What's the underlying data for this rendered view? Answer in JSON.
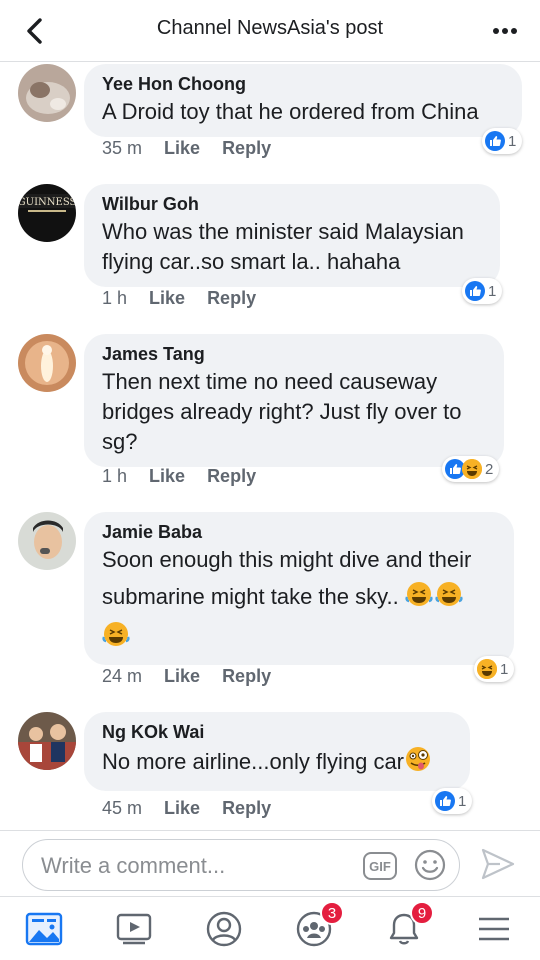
{
  "header": {
    "title": "Channel NewsAsia's post"
  },
  "comments": [
    {
      "name": "Yee Hon Choong",
      "lines": [
        "A Droid toy that he ordered from China"
      ],
      "time": "35 m",
      "like_label": "Like",
      "reply_label": "Reply",
      "reaction_count": "1",
      "reactions": [
        "like"
      ]
    },
    {
      "name": "Wilbur Goh",
      "lines": [
        "Who was the minister said Malaysian",
        "flying car..so smart la.. hahaha"
      ],
      "time": "1 h",
      "like_label": "Like",
      "reply_label": "Reply",
      "reaction_count": "1",
      "reactions": [
        "like"
      ],
      "avatar_text": "GUINNESS"
    },
    {
      "name": "James Tang",
      "lines": [
        "Then next time no need causeway",
        "bridges already right? Just fly over to",
        "sg?"
      ],
      "time": "1 h",
      "like_label": "Like",
      "reply_label": "Reply",
      "reaction_count": "2",
      "reactions": [
        "like",
        "haha"
      ]
    },
    {
      "name": "Jamie Baba",
      "lines": [
        "Soon enough this might dive and their",
        "submarine might take the sky.."
      ],
      "time": "24 m",
      "like_label": "Like",
      "reply_label": "Reply",
      "reaction_count": "1",
      "reactions": [
        "haha"
      ]
    },
    {
      "name": "Ng KOk Wai",
      "lines": [
        "No more airline...only flying car"
      ],
      "time": "45 m",
      "like_label": "Like",
      "reply_label": "Reply",
      "reaction_count": "1",
      "reactions": [
        "like"
      ]
    }
  ],
  "composer": {
    "placeholder": "Write a comment...",
    "gif_label": "GIF"
  },
  "tabbar": {
    "items": [
      {
        "icon": "news-feed-icon",
        "active": true
      },
      {
        "icon": "watch-icon"
      },
      {
        "icon": "profile-icon"
      },
      {
        "icon": "groups-icon",
        "badge": "3"
      },
      {
        "icon": "notifications-icon",
        "badge": "9"
      },
      {
        "icon": "menu-icon"
      }
    ]
  },
  "colors": {
    "accent": "#1877f2",
    "badge": "#e41e3f",
    "bubble": "#f0f2f5"
  }
}
